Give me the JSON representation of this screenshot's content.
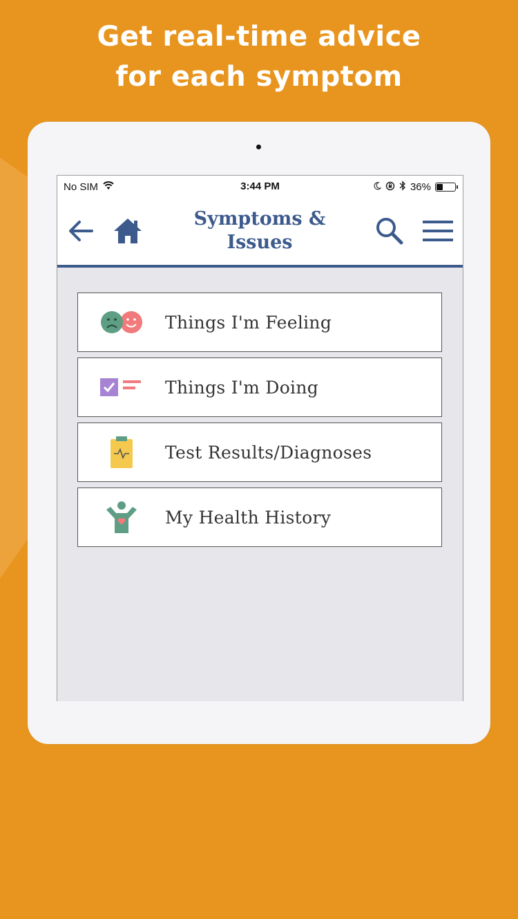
{
  "promo": {
    "headline_line1": "Get real-time advice",
    "headline_line2": "for each symptom",
    "background_color": "#E8951F"
  },
  "status_bar": {
    "carrier": "No SIM",
    "time": "3:44 PM",
    "battery": "36%",
    "battery_level": 0.36,
    "icons": [
      "wifi-icon",
      "moon-icon",
      "rotation-lock-icon",
      "bluetooth-icon",
      "battery-icon"
    ]
  },
  "nav": {
    "title_line1": "Symptoms &",
    "title_line2": "Issues",
    "accent_color": "#3C5A8C",
    "icons": [
      "back-arrow-icon",
      "home-icon",
      "search-icon",
      "menu-icon"
    ]
  },
  "items": [
    {
      "label": "Things I'm Feeling",
      "icon": "sad-happy-faces-icon"
    },
    {
      "label": "Things I'm Doing",
      "icon": "checklist-icon"
    },
    {
      "label": "Test Results/Diagnoses",
      "icon": "clipboard-icon"
    },
    {
      "label": "My Health History",
      "icon": "person-heart-icon"
    }
  ]
}
